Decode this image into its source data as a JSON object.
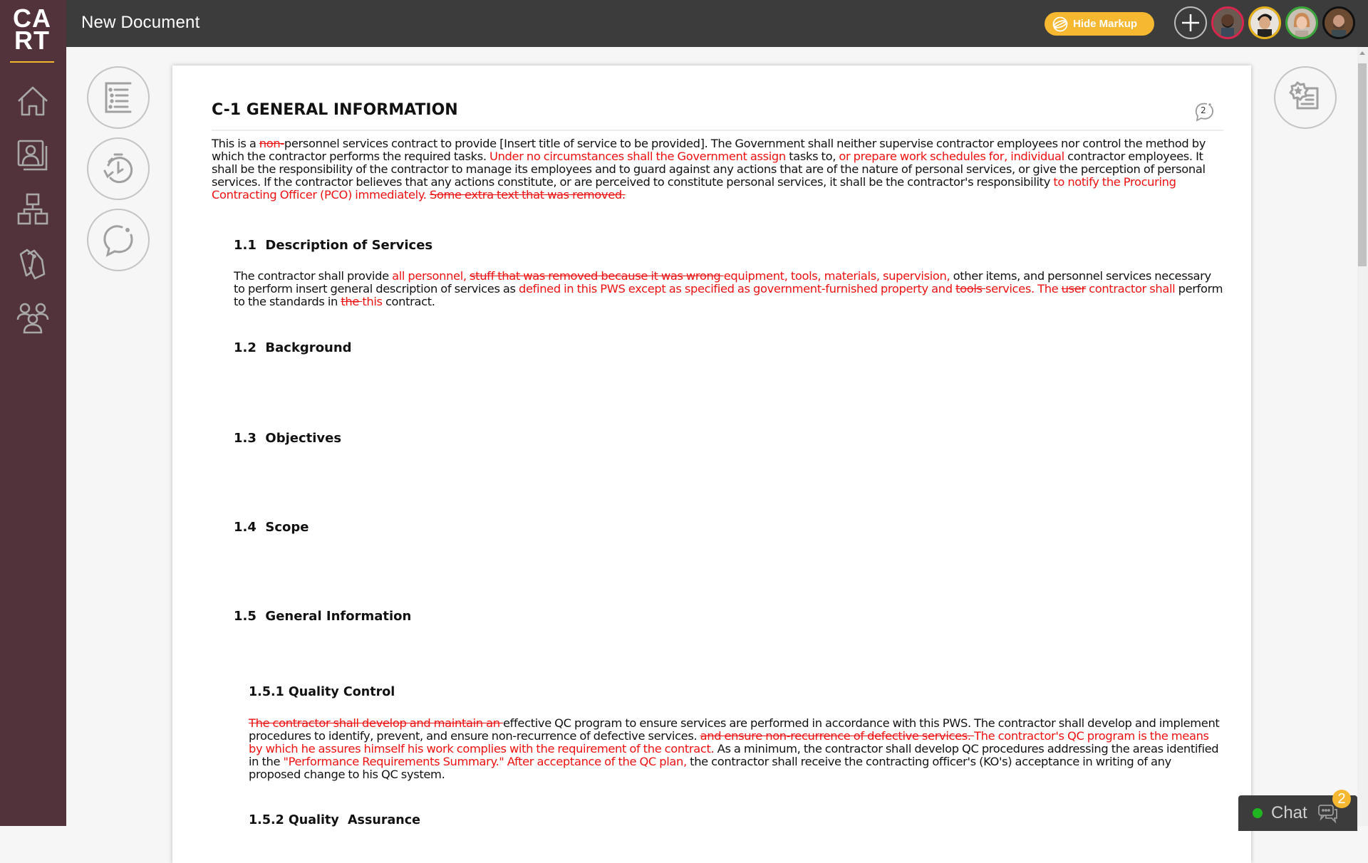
{
  "app": {
    "logo_line1": "CA",
    "logo_line2": "RT",
    "title": "New Document"
  },
  "header": {
    "hide_markup_label": "Hide Markup",
    "add_collaborator_icon": "plus-icon",
    "avatars": [
      {
        "name": "collaborator-1",
        "ring_color": "#d8264f"
      },
      {
        "name": "collaborator-2",
        "ring_color": "#e8b21c"
      },
      {
        "name": "collaborator-3",
        "ring_color": "#3aa73a"
      },
      {
        "name": "collaborator-4",
        "ring_color": "#111111"
      }
    ]
  },
  "sidebar": {
    "items": [
      {
        "name": "home",
        "icon": "home-icon"
      },
      {
        "name": "contacts",
        "icon": "contact-book-icon"
      },
      {
        "name": "hierarchy",
        "icon": "org-chart-icon"
      },
      {
        "name": "tags",
        "icon": "tags-icon"
      },
      {
        "name": "team",
        "icon": "team-icon"
      }
    ]
  },
  "tools": {
    "left": [
      {
        "name": "outline",
        "icon": "list-icon"
      },
      {
        "name": "history",
        "icon": "history-icon"
      },
      {
        "name": "comments",
        "icon": "comment-icon"
      }
    ],
    "right": {
      "name": "certificate",
      "icon": "certificate-icon"
    }
  },
  "document": {
    "title": "C-1 GENERAL INFORMATION",
    "comment_count": "2",
    "intro": [
      {
        "t": "n",
        "s": "This is a "
      },
      {
        "t": "d",
        "s": "non-"
      },
      {
        "t": "n",
        "s": "personnel services contract to provide [Insert title of service to be provided]. The Government shall neither supervise contractor employees nor control the method by which the contractor performs the required tasks. "
      },
      {
        "t": "i",
        "s": "Under no circumstances shall the Government assign"
      },
      {
        "t": "n",
        "s": " tasks to, "
      },
      {
        "t": "i",
        "s": "or prepare work schedules for, individual"
      },
      {
        "t": "n",
        "s": " contractor employees. It shall be the responsibility of the contractor to manage its employees and to guard against any actions that are of the nature of personal services, or give the perception of personal services. If the contractor believes that any actions constitute, or are perceived to constitute personal services, it shall be the contractor's responsibility "
      },
      {
        "t": "i",
        "s": "to notify the Procuring Contracting Officer (PCO) immediately. "
      },
      {
        "t": "d",
        "s": "Some extra text that was removed."
      }
    ],
    "sections": [
      {
        "heading": "1.1  Description of Services",
        "body": [
          {
            "t": "n",
            "s": "The contractor shall provide "
          },
          {
            "t": "i",
            "s": "all personnel,  "
          },
          {
            "t": "d",
            "s": "stuff that was removed because it was wrong "
          },
          {
            "t": "i",
            "s": "equipment, tools, materials, supervision,"
          },
          {
            "t": "n",
            "s": " other items, and personnel services necessary to perform insert general description of services as "
          },
          {
            "t": "i",
            "s": "defined in this PWS except as specified as government-furnished property and "
          },
          {
            "t": "d",
            "s": "tools "
          },
          {
            "t": "i",
            "s": "services. The "
          },
          {
            "t": "d",
            "s": "user"
          },
          {
            "t": "i",
            "s": " contractor shall"
          },
          {
            "t": "n",
            "s": " perform to the standards in "
          },
          {
            "t": "d",
            "s": "the "
          },
          {
            "t": "i",
            "s": "this"
          },
          {
            "t": "n",
            "s": " contract."
          }
        ]
      },
      {
        "heading": "1.2  Background"
      },
      {
        "heading": "1.3  Objectives"
      },
      {
        "heading": "1.4  Scope"
      },
      {
        "heading": "1.5  General Information"
      }
    ],
    "subsections": [
      {
        "heading": "1.5.1 Quality Control",
        "body": [
          {
            "t": "d",
            "s": "The contractor shall develop and maintain an "
          },
          {
            "t": "n",
            "s": "effective QC program to ensure services are performed in accordance with this PWS. The contractor shall develop and implement procedures to identify, prevent, and ensure non-recurrence of defective services. "
          },
          {
            "t": "d",
            "s": "and ensure non-recurrence of defective services. "
          },
          {
            "t": "i",
            "s": "The contractor's QC program is the means by which he assures himself his work complies with the requirement of the contract."
          },
          {
            "t": "n",
            "s": " As a minimum, the contractor shall develop QC procedures addressing the areas identified in the "
          },
          {
            "t": "i",
            "s": "\"Performance Requirements Summary.\" After acceptance of the QC plan,"
          },
          {
            "t": "n",
            "s": " the contractor shall receive the contracting officer's (KO's) acceptance in writing of any proposed change to his QC system."
          }
        ]
      },
      {
        "heading": "1.5.2 Quality  Assurance"
      }
    ]
  },
  "chat": {
    "label": "Chat",
    "status": "online",
    "unread_count": "2",
    "status_color": "#22b522"
  },
  "colors": {
    "header_bg": "#3c3c3c",
    "sidebar_bg": "#52333c",
    "accent": "#f6b731",
    "markup_red": "#ee1111"
  }
}
